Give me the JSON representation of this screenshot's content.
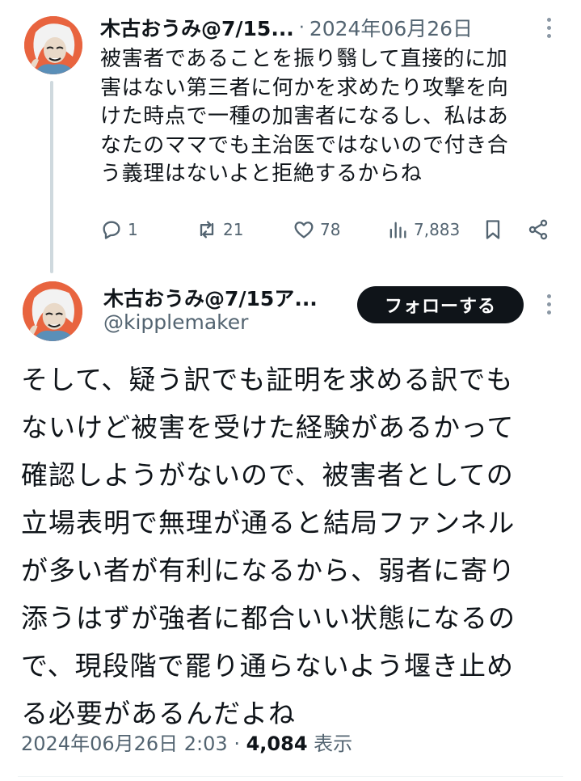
{
  "tweet1": {
    "display_name": "木古おうみ@7/15...",
    "separator": "·",
    "date": "2024年06月26日",
    "text": "被害者であることを振り翳して直接的に加\n害はない第三者に何かを求めたり攻撃を向\nけた時点で一種の加害者になるし、私はあ\nなたのママでも主治医ではないので付き合\nう義理はないよと拒絶するからね",
    "replies": "1",
    "retweets": "21",
    "likes": "78",
    "views": "7,883"
  },
  "tweet2": {
    "display_name": "木古おうみ@7/15ア...",
    "handle": "@kipplemaker",
    "follow_label": "フォローする",
    "text": "そして、疑う訳でも証明を求める訳でも\nないけど被害を受けた経験があるかって\n確認しようがないので、被害者としての\n立場表明で無理が通ると結局ファンネル\nが多い者が有利になるから、弱者に寄り\n添うはずが強者に都合いい状態になるの\nで、現段階で罷り通らないよう堰き止め\nる必要があるんだよね",
    "timestamp": "2024年06月26日 2:03",
    "separator": "·",
    "views": "4,084",
    "views_label": "表示"
  },
  "colors": {
    "text": "#0f1419",
    "secondary": "#536471",
    "avatar_bg": "#e8643f",
    "button_bg": "#0f1419"
  },
  "icons": [
    "reply-icon",
    "retweet-icon",
    "like-icon",
    "views-icon",
    "bookmark-icon",
    "share-icon",
    "more-icon"
  ]
}
